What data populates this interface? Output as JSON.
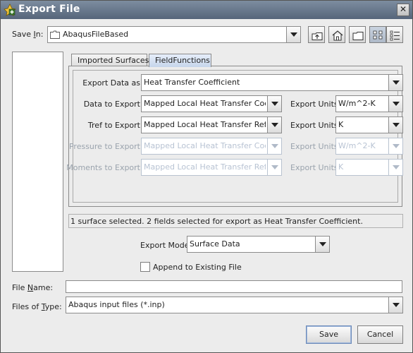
{
  "window": {
    "title": "Export File",
    "close_label": "✕"
  },
  "save_in": {
    "label_pre": "Save ",
    "label_mnemonic": "I",
    "label_post": "n:",
    "value": "AbaqusFileBased",
    "toolbar": [
      "up-one-level-icon",
      "home-icon",
      "new-folder-icon",
      "list-view-icon",
      "details-view-icon"
    ]
  },
  "tabs": [
    {
      "label": "Imported Surfaces",
      "selected": false
    },
    {
      "label": "FieldFunctions",
      "selected": true
    }
  ],
  "form": {
    "export_data_as": {
      "label": "Export Data as",
      "value": "Heat Transfer Coefficient"
    },
    "rows": [
      {
        "label": "Data to Export",
        "value": "Mapped Local Heat Transfer Coef...",
        "units_label": "Export Units",
        "units": "W/m^2-K",
        "enabled": true
      },
      {
        "label": "Tref to Export",
        "value": "Mapped Local Heat Transfer Refe...",
        "units_label": "Export Units",
        "units": "K",
        "enabled": true
      },
      {
        "label": "Pressure to Export",
        "value": "Mapped Local Heat Transfer Coef...",
        "units_label": "Export Units",
        "units": "W/m^2-K",
        "enabled": false
      },
      {
        "label": "Moments to Export",
        "value": "Mapped Local Heat Transfer Refe...",
        "units_label": "Export Units",
        "units": "K",
        "enabled": false
      }
    ]
  },
  "status_text": "1 surface selected. 2 fields selected for export as Heat Transfer Coefficient.",
  "export_mode": {
    "label": "Export Mode",
    "value": "Surface Data"
  },
  "append": {
    "label": "Append to Existing File",
    "checked": false
  },
  "file_name": {
    "label_pre": "File ",
    "label_mnemonic": "N",
    "label_post": "ame:",
    "value": ""
  },
  "file_type": {
    "label_pre": "Files of ",
    "label_mnemonic": "T",
    "label_post": "ype:",
    "value": "Abaqus input files (*.inp)"
  },
  "buttons": {
    "save": "Save",
    "cancel": "Cancel"
  }
}
